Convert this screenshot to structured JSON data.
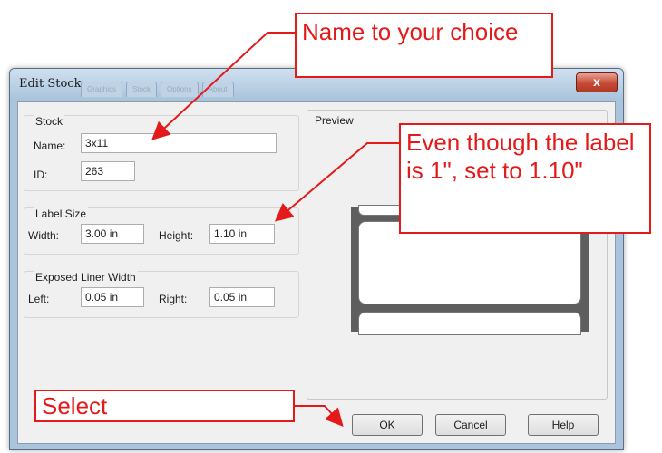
{
  "dialog": {
    "title": "Edit Stock",
    "ghost_tabs": [
      "Graphics",
      "Stock",
      "Options",
      "About"
    ],
    "close_glyph": "x"
  },
  "stock": {
    "legend": "Stock",
    "name_label": "Name:",
    "name_value": "3x11",
    "id_label": "ID:",
    "id_value": "263"
  },
  "label_size": {
    "legend": "Label Size",
    "width_label": "Width:",
    "width_value": "3.00 in",
    "height_label": "Height:",
    "height_value": "1.10 in"
  },
  "liner": {
    "legend": "Exposed Liner Width",
    "left_label": "Left:",
    "left_value": "0.05 in",
    "right_label": "Right:",
    "right_value": "0.05 in"
  },
  "preview": {
    "title": "Preview"
  },
  "buttons": {
    "ok": "OK",
    "cancel": "Cancel",
    "help": "Help"
  },
  "annotations": {
    "name": "Name to your choice",
    "height": "Even though the label is 1\", set to 1.10\"",
    "select": "Select"
  },
  "colors": {
    "annotation": "#e41a1a",
    "titlebar": "#a9c4dc",
    "close_button": "#c64b36"
  }
}
